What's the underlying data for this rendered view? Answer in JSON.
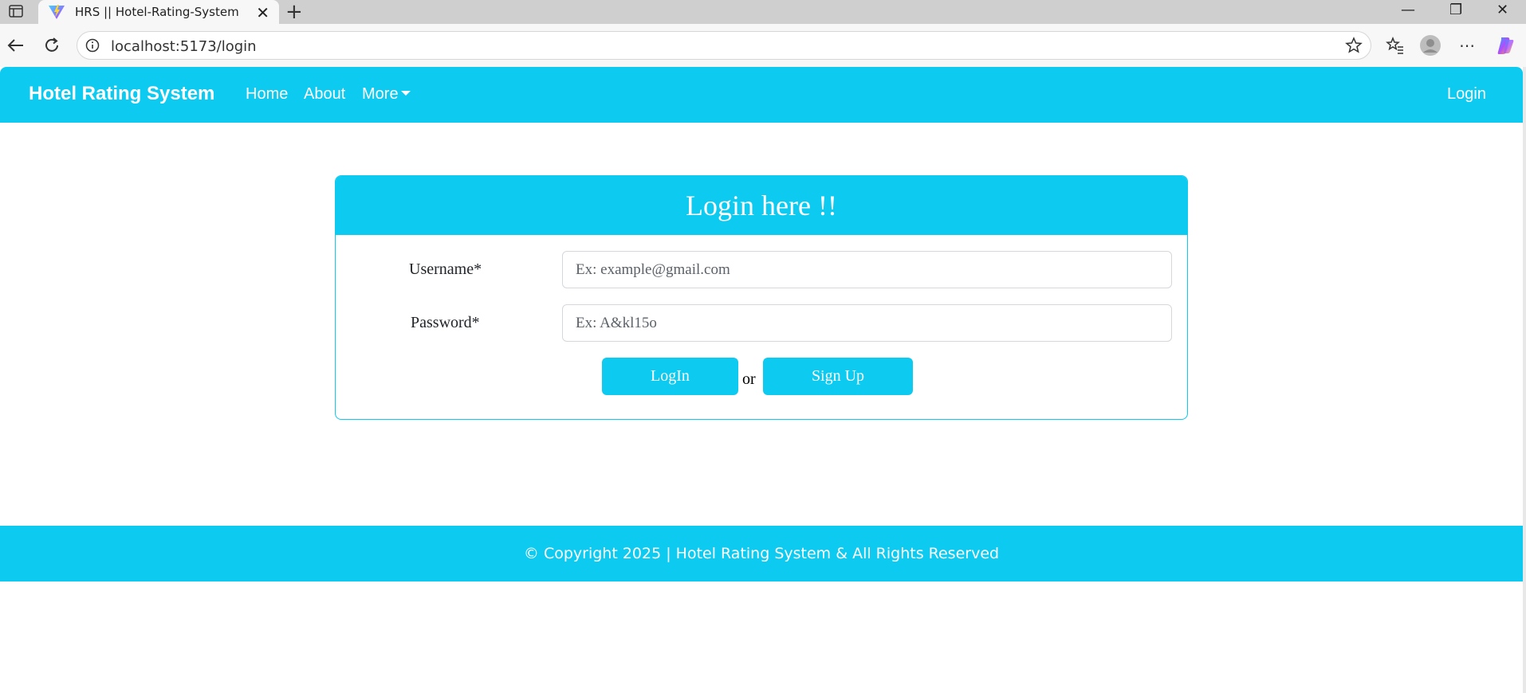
{
  "browser": {
    "tab_title": "HRS || Hotel-Rating-System",
    "tab_close": "✕",
    "new_tab": "+",
    "url": "localhost:5173/login",
    "window_controls": {
      "minimize": "—",
      "restore": "❐",
      "close": "✕"
    },
    "menu": "⋯"
  },
  "navbar": {
    "brand": "Hotel Rating System",
    "links": [
      {
        "label": "Home"
      },
      {
        "label": "About"
      },
      {
        "label": "More"
      }
    ],
    "login": "Login",
    "color": "#0dcaf0"
  },
  "login_card": {
    "title": "Login here !!",
    "username_label": "Username*",
    "username_placeholder": "Ex: example@gmail.com",
    "password_label": "Password*",
    "password_placeholder": "Ex: A&kl15o",
    "login_button": "LogIn",
    "or_text": "or",
    "signup_button": "Sign Up"
  },
  "footer": {
    "text": "© Copyright 2025 | Hotel Rating System & All Rights Reserved"
  }
}
